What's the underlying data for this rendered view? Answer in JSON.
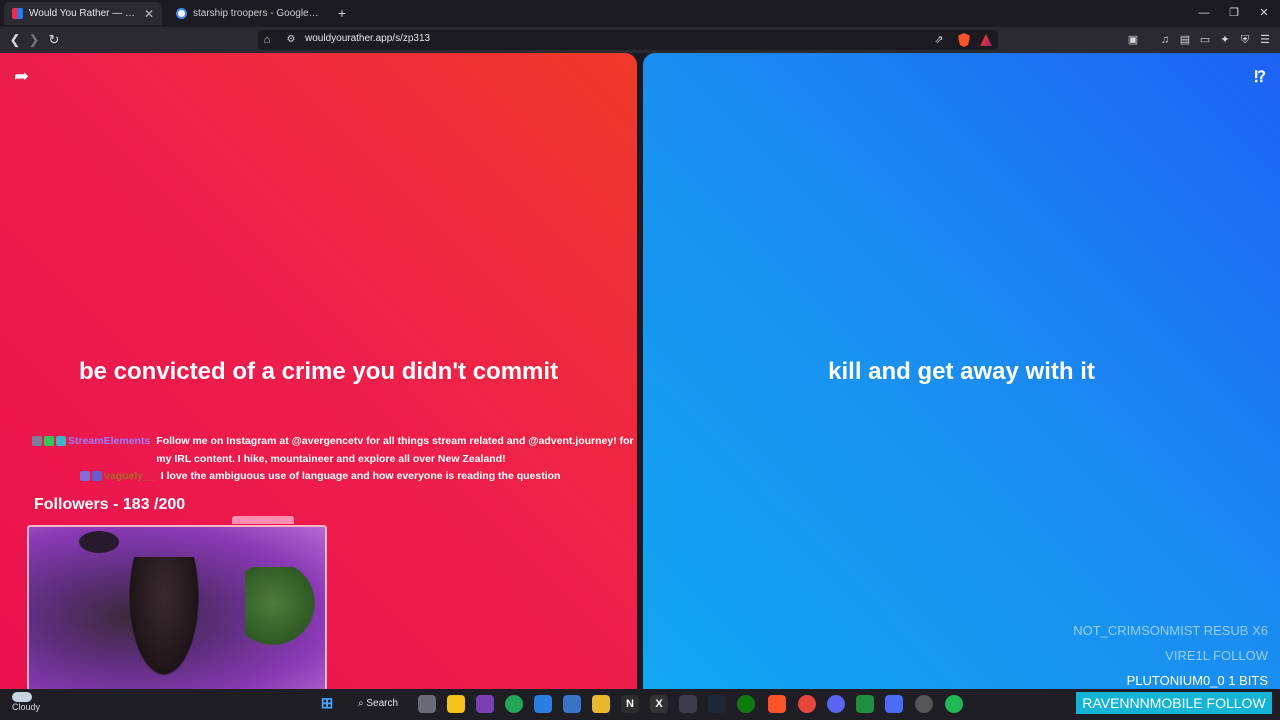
{
  "browser": {
    "tabs": [
      {
        "title": "Would You Rather — Play the O",
        "close": "✕",
        "active": true
      },
      {
        "title": "starship troopers - Google Search",
        "active": false
      }
    ],
    "new_tab": "+",
    "window_controls": {
      "minimize": "—",
      "maximize": "❐",
      "close": "✕"
    },
    "url": "wouldyourather.app/s/zp313"
  },
  "page": {
    "option_a": "be convicted of a crime you didn't commit",
    "option_b": "kill and get away with it",
    "help_label": "⁉",
    "share_glyph": "➦",
    "colors": {
      "red": "#ef1f4b",
      "blue": "#1a8ef1"
    }
  },
  "overlay": {
    "chat": [
      {
        "user": "StreamElements",
        "message": "Follow me on Instagram at @avergencetv for all things stream related and @advent.journey! for my IRL content. I hike, mountaineer and explore all over New Zealand!"
      },
      {
        "user": "vaguely__",
        "message": "I love the ambiguous use of language and how everyone is reading the question"
      }
    ],
    "followers_goal": "Followers - 183 /200",
    "alerts": [
      "NOT_CRIMSONMIST  RESUB X6",
      "VIRE1L  FOLLOW",
      "PLUTONIUM0_0  1 BITS"
    ],
    "latest_alert": "RAVENNNMOBILE  FOLLOW"
  },
  "taskbar": {
    "weather": "Cloudy",
    "search_label": "Search"
  }
}
